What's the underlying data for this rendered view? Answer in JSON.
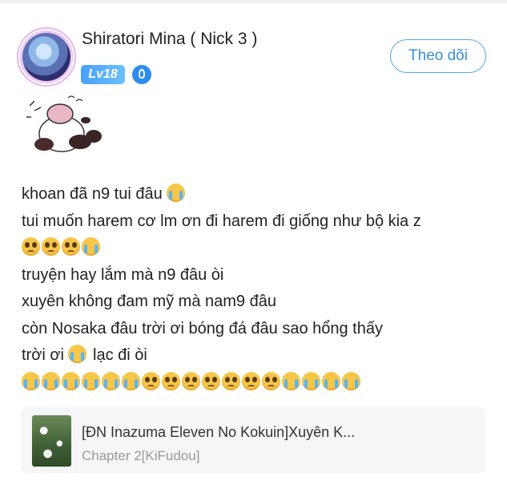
{
  "user": {
    "name": "Shiratori Mina ( Nick 3 )",
    "level_badge": "Lv18",
    "follow_label": "Theo dõi"
  },
  "comment": {
    "lines": [
      {
        "text": "khoan đã n9 tui đâu ",
        "emojis": [
          "crying-face"
        ]
      },
      {
        "text": "tui muốn harem cơ lm ơn đi harem đi giống như bộ kia z",
        "emojis": []
      },
      {
        "text": "",
        "emojis": [
          "pleading-face",
          "pleading-face",
          "pleading-face",
          "crying-face"
        ]
      },
      {
        "text": "truyện hay lắm mà n9 đâu òi",
        "emojis": []
      },
      {
        "text": "xuyên không đam mỹ mà nam9 đâu",
        "emojis": []
      },
      {
        "text": "còn Nosaka đâu trời ơi bóng đá đâu sao hổng thấy",
        "emojis": []
      },
      {
        "text": "trời ơi ",
        "emojis": [
          "crying-face"
        ],
        "suffix": " lạc đi òi"
      },
      {
        "text": "",
        "emojis": [
          "crying-face",
          "crying-face",
          "crying-face",
          "crying-face",
          "crying-face",
          "crying-face",
          "pleading-face",
          "pleading-face",
          "pleading-face",
          "pleading-face",
          "pleading-face",
          "pleading-face",
          "pleading-face",
          "crying-face",
          "crying-face",
          "crying-face",
          "crying-face"
        ]
      }
    ]
  },
  "book": {
    "title": "[ĐN Inazuma Eleven No Kokuin]Xuyên K...",
    "chapter": "Chapter 2[KiFudou]"
  },
  "icons": {
    "verify": "verified-badge-icon",
    "sticker": "panda-sticker"
  },
  "colors": {
    "accent": "#57a6ea",
    "level_badge": "#4aa0ff"
  }
}
